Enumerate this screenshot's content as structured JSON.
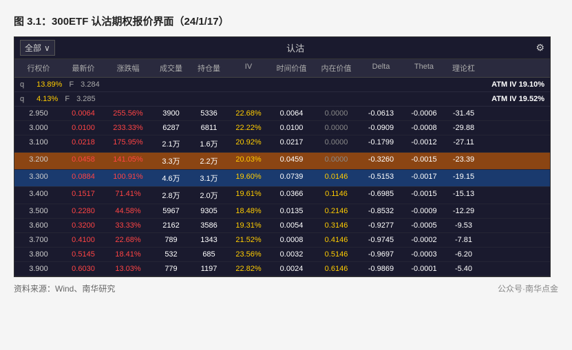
{
  "title": "图 3.1：300ETF 认沽期权报价界面（24/1/17）",
  "top_bar": {
    "dropdown_label": "全部",
    "center_label": "认沽",
    "gear": "⚙"
  },
  "headers": [
    "行权价",
    "最新价",
    "涨跌幅",
    "成交量",
    "持仓量",
    "IV",
    "时间价值",
    "内在价值",
    "Delta",
    "Theta",
    "理论杠"
  ],
  "atm_rows": [
    {
      "q_f": "q",
      "iv_pct": "13.89%",
      "f_label": "F",
      "f_val": "3.284",
      "atm_tag": "ATM IV 19.10%"
    },
    {
      "q_f": "q",
      "iv_pct": "4.13%",
      "f_label": "F",
      "f_val": "3.285",
      "atm_tag": "ATM IV 19.52%"
    }
  ],
  "rows": [
    {
      "strike": "2.950",
      "latest": "0.0064",
      "change": "255.56%",
      "vol": "3900",
      "oi": "5336",
      "iv": "22.68%",
      "time_val": "0.0064",
      "inner_val": "0.0000",
      "delta": "-0.0613",
      "theta": "-0.0006",
      "lever": "-31.45",
      "highlight": ""
    },
    {
      "strike": "3.000",
      "latest": "0.0100",
      "change": "233.33%",
      "vol": "6287",
      "oi": "6811",
      "iv": "22.22%",
      "time_val": "0.0100",
      "inner_val": "0.0000",
      "delta": "-0.0909",
      "theta": "-0.0008",
      "lever": "-29.88",
      "highlight": ""
    },
    {
      "strike": "3.100",
      "latest": "0.0218",
      "change": "175.95%",
      "vol": "2.1万",
      "oi": "1.6万",
      "iv": "20.92%",
      "time_val": "0.0217",
      "inner_val": "0.0000",
      "delta": "-0.1799",
      "theta": "-0.0012",
      "lever": "-27.11",
      "highlight": ""
    },
    {
      "strike": "3.200",
      "latest": "0.0458",
      "change": "141.05%",
      "vol": "3.3万",
      "oi": "2.2万",
      "iv": "20.03%",
      "time_val": "0.0459",
      "inner_val": "0.0000",
      "delta": "-0.3260",
      "theta": "-0.0015",
      "lever": "-23.39",
      "highlight": "orange"
    },
    {
      "strike": "3.300",
      "latest": "0.0884",
      "change": "100.91%",
      "vol": "4.6万",
      "oi": "3.1万",
      "iv": "19.60%",
      "time_val": "0.0739",
      "inner_val": "0.0146",
      "delta": "-0.5153",
      "theta": "-0.0017",
      "lever": "-19.15",
      "highlight": "blue"
    },
    {
      "strike": "3.400",
      "latest": "0.1517",
      "change": "71.41%",
      "vol": "2.8万",
      "oi": "2.0万",
      "iv": "19.61%",
      "time_val": "0.0366",
      "inner_val": "0.1146",
      "delta": "-0.6985",
      "theta": "-0.0015",
      "lever": "-15.13",
      "highlight": ""
    },
    {
      "strike": "3.500",
      "latest": "0.2280",
      "change": "44.58%",
      "vol": "5967",
      "oi": "9305",
      "iv": "18.48%",
      "time_val": "0.0135",
      "inner_val": "0.2146",
      "delta": "-0.8532",
      "theta": "-0.0009",
      "lever": "-12.29",
      "highlight": ""
    },
    {
      "strike": "3.600",
      "latest": "0.3200",
      "change": "33.33%",
      "vol": "2162",
      "oi": "3586",
      "iv": "19.31%",
      "time_val": "0.0054",
      "inner_val": "0.3146",
      "delta": "-0.9277",
      "theta": "-0.0005",
      "lever": "-9.53",
      "highlight": ""
    },
    {
      "strike": "3.700",
      "latest": "0.4100",
      "change": "22.68%",
      "vol": "789",
      "oi": "1343",
      "iv": "21.52%",
      "time_val": "0.0008",
      "inner_val": "0.4146",
      "delta": "-0.9745",
      "theta": "-0.0002",
      "lever": "-7.81",
      "highlight": ""
    },
    {
      "strike": "3.800",
      "latest": "0.5145",
      "change": "18.41%",
      "vol": "532",
      "oi": "685",
      "iv": "23.56%",
      "time_val": "0.0032",
      "inner_val": "0.5146",
      "delta": "-0.9697",
      "theta": "-0.0003",
      "lever": "-6.20",
      "highlight": ""
    },
    {
      "strike": "3.900",
      "latest": "0.6030",
      "change": "13.03%",
      "vol": "779",
      "oi": "1197",
      "iv": "22.82%",
      "time_val": "0.0024",
      "inner_val": "0.6146",
      "delta": "-0.9869",
      "theta": "-0.0001",
      "lever": "-5.40",
      "highlight": ""
    }
  ],
  "source": "资料来源：Wind、南华研究",
  "brand": "公众号·南华点金"
}
